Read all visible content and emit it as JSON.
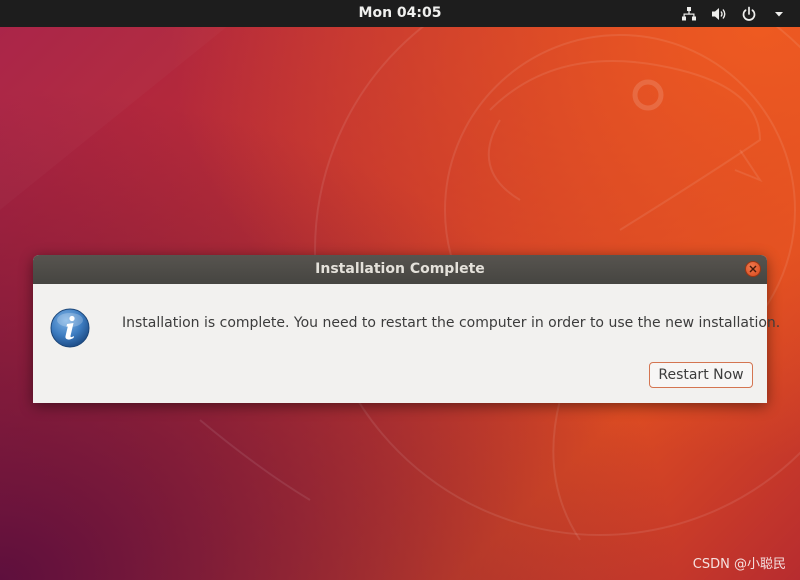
{
  "top_bar": {
    "clock": "Mon 04:05",
    "tray_icons": [
      "network-wired-icon",
      "volume-icon",
      "power-icon",
      "menu-arrow-down-icon"
    ]
  },
  "dialog": {
    "title": "Installation Complete",
    "icon": "info-icon",
    "message": "Installation is complete. You need to restart the computer in order to use the new installation.",
    "restart_label": "Restart Now"
  },
  "watermark": "CSDN @小聪民",
  "colors": {
    "top_bar": "#1d1d1d",
    "dialog_bg": "#f2f1ef",
    "titlebar": "#4d4b46",
    "close_button": "#e05a2b",
    "button_border": "#d47551",
    "info_icon": "#3d7cc0"
  }
}
